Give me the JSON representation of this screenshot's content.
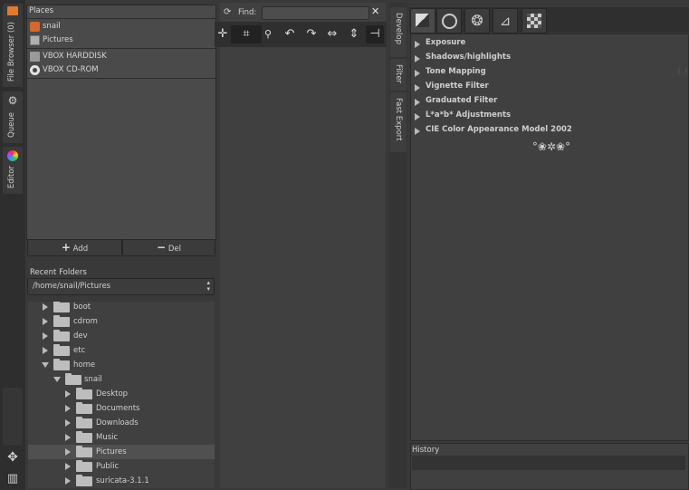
{
  "left_tabs": {
    "file_browser": "File Browser (0)",
    "queue": "Queue",
    "editor": "Editor"
  },
  "places": {
    "title": "Places",
    "items": [
      "snail",
      "Pictures",
      "VBOX HARDDISK",
      "VBOX CD-ROM"
    ],
    "add_label": "Add",
    "del_label": "Del"
  },
  "recent": {
    "title": "Recent Folders",
    "selected": "/home/snail/Pictures"
  },
  "tree": {
    "items": [
      {
        "label": "boot"
      },
      {
        "label": "cdrom"
      },
      {
        "label": "dev"
      },
      {
        "label": "etc"
      },
      {
        "label": "home"
      },
      {
        "label": "snail"
      },
      {
        "label": "Desktop"
      },
      {
        "label": "Documents"
      },
      {
        "label": "Downloads"
      },
      {
        "label": "Music"
      },
      {
        "label": "Pictures"
      },
      {
        "label": "Public"
      },
      {
        "label": "suricata-3.1.1"
      }
    ]
  },
  "center": {
    "find_label": "Find:",
    "find_value": "",
    "close_glyph": "✕"
  },
  "right_tabs": {
    "develop": "Develop",
    "filter": "Filter",
    "fast_export": "Fast Export"
  },
  "tool_panel": {
    "sections": [
      "Exposure",
      "Shadows/highlights",
      "Tone Mapping",
      "Vignette Filter",
      "Graduated Filter",
      "L*a*b* Adjustments",
      "CIE Color Appearance Model 2002"
    ],
    "ornament": "°❀✲❀°"
  },
  "history": {
    "title": "History"
  },
  "colors": {
    "background": "#393939",
    "panel": "#404040",
    "text": "#c8c8c8"
  }
}
